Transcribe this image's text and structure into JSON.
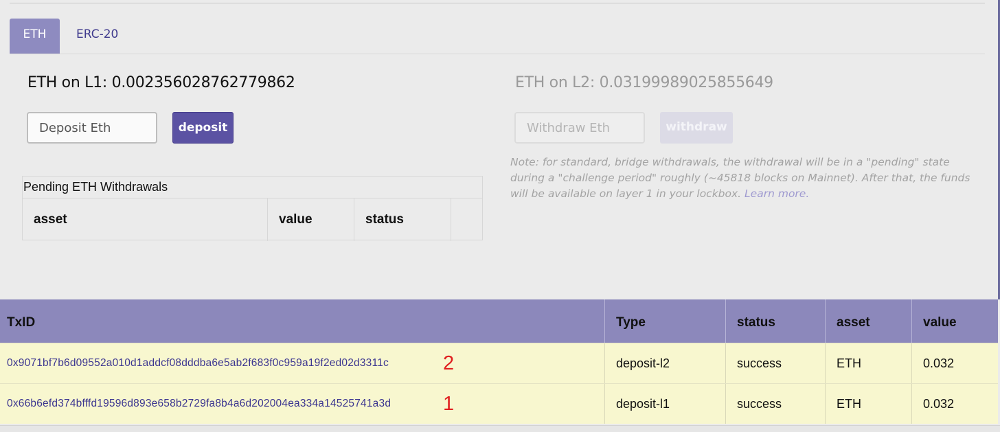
{
  "tabs": [
    {
      "label": "ETH",
      "active": true
    },
    {
      "label": "ERC-20",
      "active": false
    }
  ],
  "l1": {
    "balance_text": "ETH on L1: 0.002356028762779862",
    "input_placeholder": "Deposit Eth",
    "button_label": "deposit"
  },
  "l2": {
    "balance_text": "ETH on L2: 0.03199989025855649",
    "input_placeholder": "Withdraw Eth",
    "button_label": "withdraw",
    "note": "Note: for standard, bridge withdrawals, the withdrawal will be in a \"pending\" state during a \"challenge period\" roughly (~45818 blocks on Mainnet). After that, the funds will be available on layer 1 in your lockbox.",
    "learn_more": "Learn more."
  },
  "pending": {
    "title": "Pending ETH Withdrawals",
    "columns": [
      "asset",
      "value",
      "status",
      ""
    ]
  },
  "transactions": {
    "columns": [
      "TxID",
      "Type",
      "status",
      "asset",
      "value"
    ],
    "rows": [
      {
        "txid": "0x9071bf7b6d09552a010d1addcf08dddba6e5ab2f683f0c959a19f2ed02d3311c",
        "marker": "2",
        "type": "deposit-l2",
        "status": "success",
        "asset": "ETH",
        "value": "0.032"
      },
      {
        "txid": "0x66b6efd374bfffd19596d893e658b2729fa8b4a6d202004ea334a14525741a3d",
        "marker": "1",
        "type": "deposit-l1",
        "status": "success",
        "asset": "ETH",
        "value": "0.032"
      }
    ]
  },
  "colors": {
    "accent": "#5b52a3",
    "table_header": "#8c88bb",
    "row_bg": "#f8f7cf",
    "link": "#3b3590",
    "marker": "#e02020"
  }
}
